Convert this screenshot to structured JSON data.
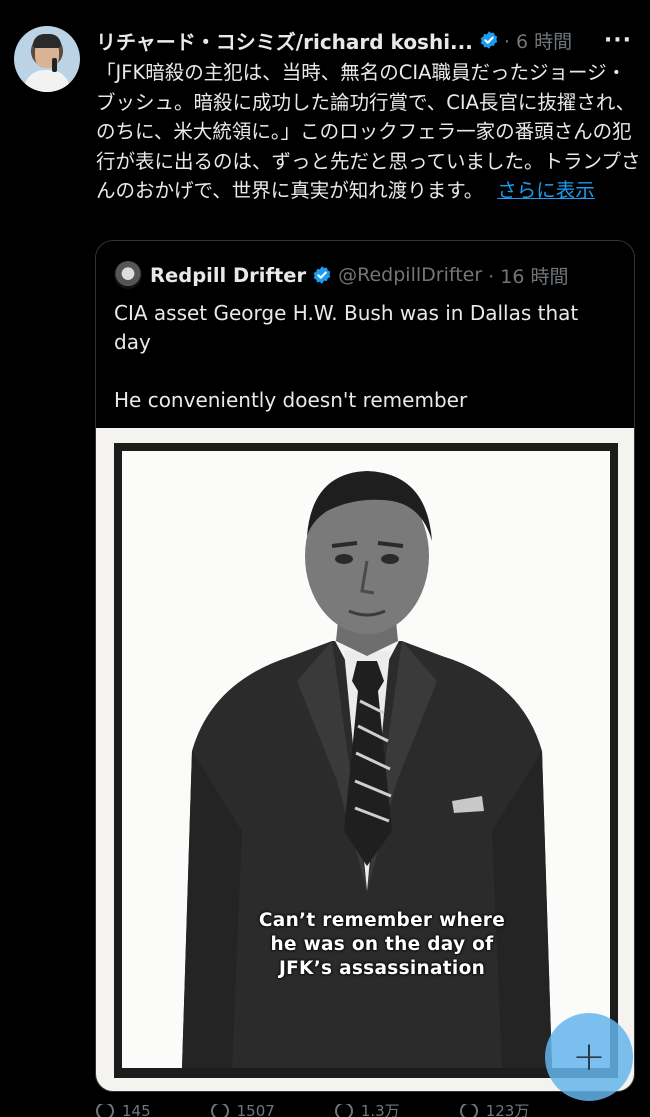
{
  "tweet": {
    "author_name": "リチャード・コシミズ/richard koshi...",
    "time": "· 6 時間",
    "more_label": "···",
    "text": "「JFK暗殺の主犯は、当時、無名のCIA職員だったジョージ・ブッシュ。暗殺に成功した論功行賞で、CIA長官に抜擢され、のちに、米大統領に。」このロックフェラ一家の番頭さんの犯行が表に出るのは、ずっと先だと思っていました。トランプさんのおかげで、世界に真実が知れ渡ります。",
    "show_more": "さらに表示"
  },
  "quote": {
    "author_name": "Redpill Drifter",
    "handle": "@RedpillDrifter",
    "time": "· 16 時間",
    "text": "CIA asset George H.W. Bush was in Dallas that day\n\nHe conveniently doesn't remember",
    "image_caption": "Can’t remember where he was on the day of JFK’s assassination"
  },
  "actions": {
    "reply_count": "145",
    "retweet_count": "1507",
    "like_count": "1.3万",
    "views_count": "123万"
  },
  "fab": {
    "label": "+"
  },
  "colors": {
    "accent": "#1d9bf0",
    "muted": "#71767b",
    "background": "#000000"
  }
}
